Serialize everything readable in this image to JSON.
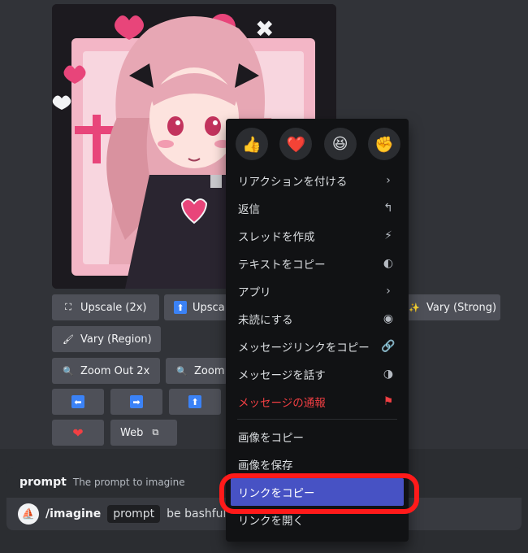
{
  "buttons": {
    "upscale_2x": "Upscale (2x)",
    "upscale_cut": "Upsca",
    "vary_strong": "Vary (Strong)",
    "vary_region": "Vary (Region)",
    "zoom_out_2x": "Zoom Out 2x",
    "zoom_cut": "Zoom",
    "web": "Web"
  },
  "icons": {
    "upscale": "⛶",
    "upscale2": "⬆",
    "vary_strong": "✨",
    "brush": "🖌",
    "zoom": "🔍",
    "left": "⬅",
    "right": "➡",
    "up": "⬆",
    "heart": "❤",
    "external": "⧉"
  },
  "reactions": [
    "👍",
    "❤️",
    "😆",
    "✊"
  ],
  "menu": {
    "items": [
      {
        "label": "リアクションを付ける",
        "icon": "›"
      },
      {
        "label": "返信",
        "icon": "↰"
      },
      {
        "label": "スレッドを作成",
        "icon": "⚡"
      },
      {
        "label": "テキストをコピー",
        "icon": "◐"
      },
      {
        "label": "アプリ",
        "icon": "›"
      },
      {
        "label": "未読にする",
        "icon": "◉"
      },
      {
        "label": "メッセージリンクをコピー",
        "icon": "🔗"
      },
      {
        "label": "メッセージを話す",
        "icon": "◑"
      },
      {
        "label": "メッセージの通報",
        "icon": "⚑"
      }
    ],
    "image_items": [
      {
        "label": "画像をコピー"
      },
      {
        "label": "画像を保存"
      },
      {
        "label": "リンクをコピー"
      },
      {
        "label": "リンクを開く"
      }
    ]
  },
  "prompt_hint": {
    "key": "prompt",
    "desc": "The prompt to imagine"
  },
  "input": {
    "command": "/imagine",
    "chip": "prompt",
    "typed": "be bashful"
  },
  "colors": {
    "accent": "#4752c4",
    "danger": "#f23f43",
    "highlight": "#ff1a1a",
    "pink": "#e8457a"
  }
}
